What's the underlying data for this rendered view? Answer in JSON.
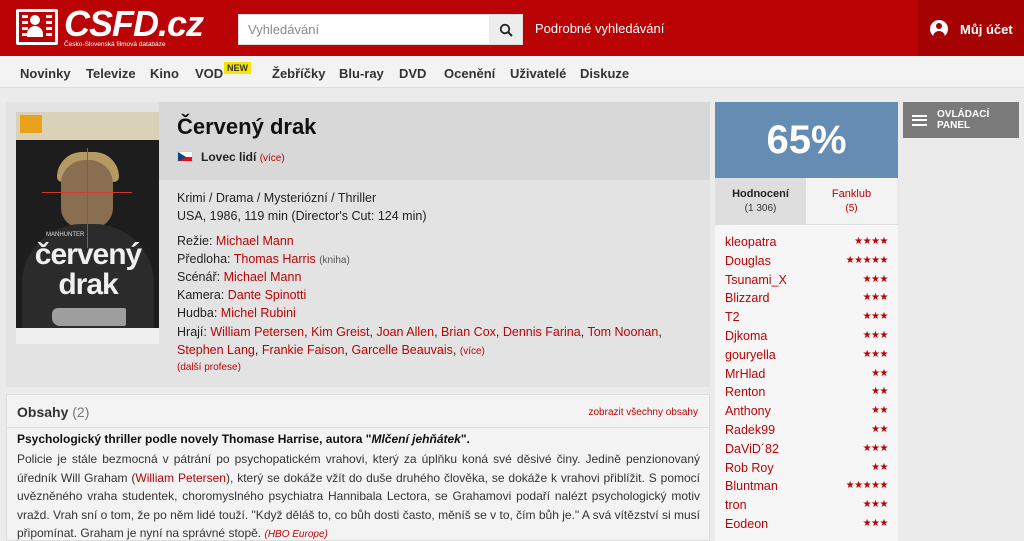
{
  "header": {
    "logo_text": "CSFD.cz",
    "logo_subtitle": "Česko-Slovenská filmová databáze",
    "search_placeholder": "Vyhledávání",
    "advanced_search": "Podrobné vyhledávání",
    "account": "Můj účet"
  },
  "nav": {
    "items": [
      "Novinky",
      "Televize",
      "Kino",
      "VOD",
      "Žebříčky",
      "Blu-ray",
      "DVD",
      "Ocenění",
      "Uživatelé",
      "Diskuze"
    ],
    "new_badge": "NEW"
  },
  "film": {
    "title": "Červený drak",
    "alt_title": "Lovec lidí",
    "alt_more": "(více)",
    "genres": "Krimi / Drama / Mysteriózní / Thriller",
    "origin": "USA, 1986, 119 min (Director's Cut: 124 min)",
    "poster_title": "červený drak",
    "poster_top": "MANHUNTER",
    "credits": [
      {
        "label": "Režie:",
        "value": "Michael Mann",
        "note": ""
      },
      {
        "label": "Předloha:",
        "value": "Thomas Harris",
        "note": "(kniha)"
      },
      {
        "label": "Scénář:",
        "value": "Michael Mann",
        "note": ""
      },
      {
        "label": "Kamera:",
        "value": "Dante Spinotti",
        "note": ""
      },
      {
        "label": "Hudba:",
        "value": "Michel Rubini",
        "note": ""
      }
    ],
    "actors_label": "Hrají:",
    "actors": [
      "William Petersen",
      "Kim Greist",
      "Joan Allen",
      "Brian Cox",
      "Dennis Farina",
      "Tom Noonan",
      "Stephen Lang",
      "Frankie Faison",
      "Garcelle Beauvais"
    ],
    "actors_more": "(více)",
    "more_professions": "(další profese)"
  },
  "plot": {
    "heading": "Obsahy",
    "count": "(2)",
    "show_all": "zobrazit všechny obsahy",
    "lead_prefix": "Psychologický thriller podle novely Thomase Harrise, autora \"",
    "lead_book": "Mlčení jehňátek",
    "lead_suffix": "\".",
    "text_1": "Policie je stále bezmocná v pátrání po psychopatickém vrahovi, který za úplňku koná své děsivé činy. Jedině penzionovaný úředník Will Graham (",
    "text_actor": "William Petersen",
    "text_2": "), který se dokáže vžít do duše druhého člověka, se dokáže k vrahovi přiblížit. S pomocí uvězněného vraha studentek, choromyslného psychiatra Hannibala Lectora, se Grahamovi podaří nalézt psychologický motiv vražd. Vrah sní o tom, že po něm lidé touží. \"Když děláš to, co bůh dosti často, měníš se v to, čím bůh je.\" A svá vítězství si musí připomínat. Graham je nyní na správné stopě.",
    "source": "(HBO Europe)"
  },
  "rating": {
    "percent": "65%",
    "tab_ratings": "Hodnocení",
    "tab_ratings_count": "(1 306)",
    "tab_fanclub": "Fanklub",
    "tab_fanclub_count": "(5)",
    "list": [
      {
        "user": "kleopatra",
        "stars": "★★★★"
      },
      {
        "user": "Douglas",
        "stars": "★★★★★"
      },
      {
        "user": "Tsunami_X",
        "stars": "★★★"
      },
      {
        "user": "Blizzard",
        "stars": "★★★"
      },
      {
        "user": "T2",
        "stars": "★★★"
      },
      {
        "user": "Djkoma",
        "stars": "★★★"
      },
      {
        "user": "gouryella",
        "stars": "★★★"
      },
      {
        "user": "MrHlad",
        "stars": "★★"
      },
      {
        "user": "Renton",
        "stars": "★★"
      },
      {
        "user": "Anthony",
        "stars": "★★"
      },
      {
        "user": "Radek99",
        "stars": "★★"
      },
      {
        "user": "DaViD´82",
        "stars": "★★★"
      },
      {
        "user": "Rob Roy",
        "stars": "★★"
      },
      {
        "user": "Bluntman",
        "stars": "★★★★★"
      },
      {
        "user": "tron",
        "stars": "★★★"
      },
      {
        "user": "Eodeon",
        "stars": "★★★"
      }
    ]
  },
  "control_panel": {
    "label": "OVLÁDACÍ PANEL"
  }
}
